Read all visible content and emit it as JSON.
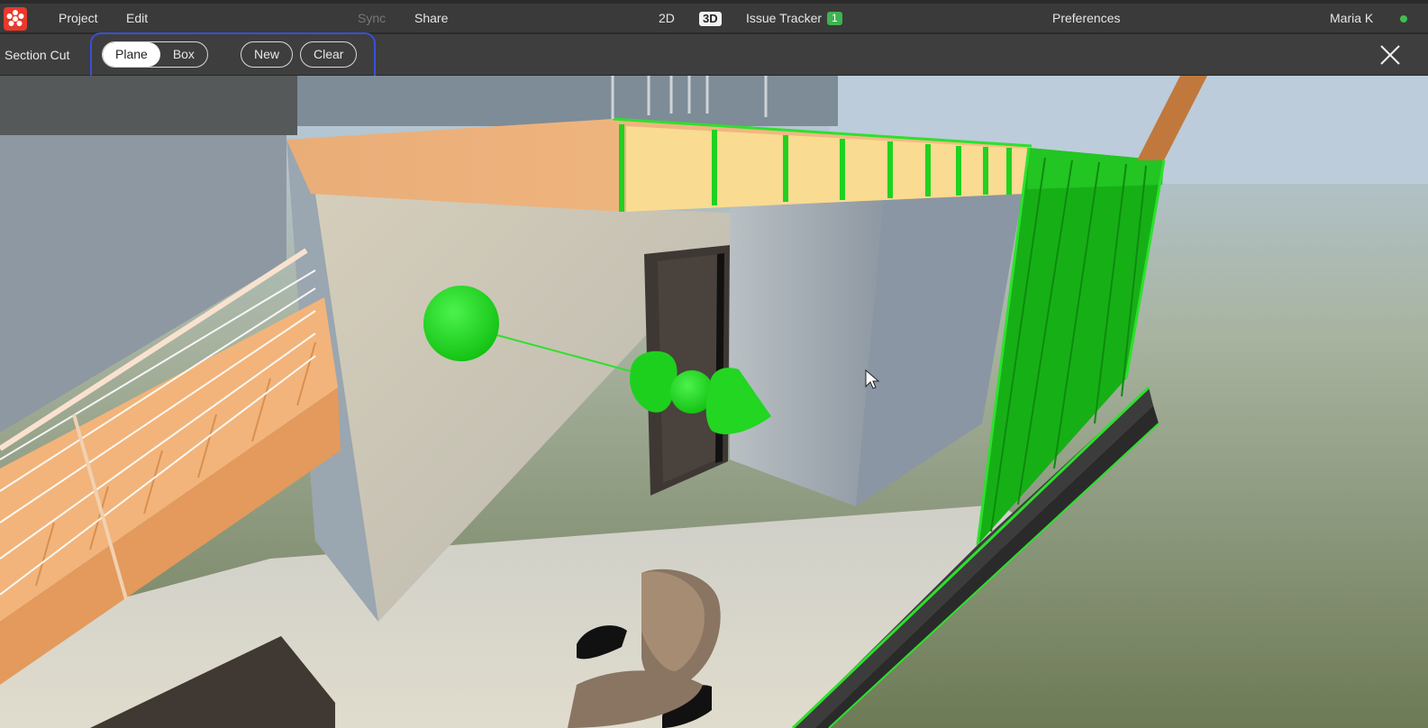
{
  "menu": {
    "project": "Project",
    "edit": "Edit",
    "sync": "Sync",
    "share": "Share",
    "view_2d": "2D",
    "view_3d": "3D",
    "issue_tracker": "Issue Tracker",
    "issue_count": "1",
    "preferences": "Preferences",
    "user": "Maria K"
  },
  "section_cut": {
    "title": "Section Cut",
    "modes": [
      "Plane",
      "Box"
    ],
    "active_mode": "Plane",
    "new_label": "New",
    "clear_label": "Clear"
  },
  "icons": {
    "logo": "app-logo-icon",
    "close": "close-icon",
    "status": "online-status-icon",
    "cursor": "mouse-cursor-icon"
  },
  "colors": {
    "accent_green": "#2ee02e",
    "highlight_blue": "#3a4fd8",
    "toolbar_bg": "#3e3e3e",
    "menubar_bg": "#3a3a3a",
    "logo_red": "#e8392c"
  }
}
